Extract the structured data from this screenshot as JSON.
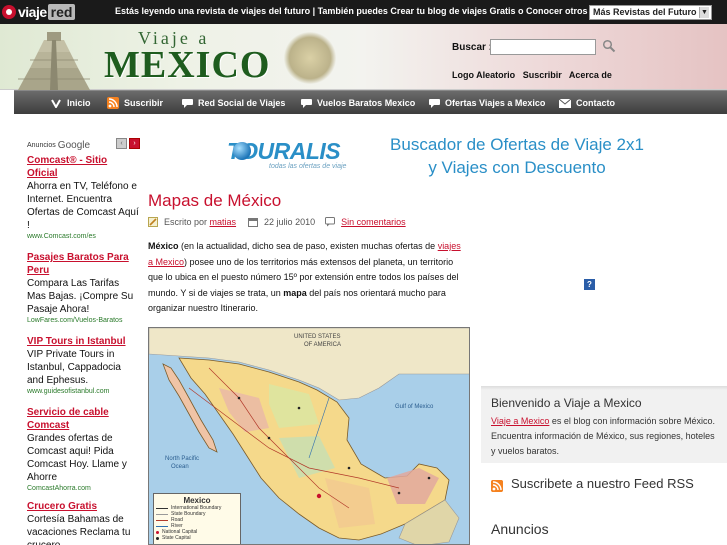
{
  "topbar": {
    "logo_part1": "viaje",
    "logo_part2": "red",
    "message": "Estás leyendo una revista de viajes del futuro | También puedes Crear tu blog de viajes Gratis o Conocer otros viajeros",
    "more_select": "Más Revistas del Futuro",
    "select_arrow": "▼"
  },
  "header": {
    "title_small": "Viaje a",
    "title_big": "MEXICO",
    "search_label": "Buscar :",
    "search_value": "",
    "links": [
      "Logo Aleatorio",
      "Suscribir",
      "Acerca de"
    ]
  },
  "nav": {
    "items": [
      {
        "label": "Inicio",
        "icon": "v-icon"
      },
      {
        "label": "Suscribir",
        "icon": "rss-icon"
      },
      {
        "label": "Red Social de Viajes",
        "icon": "chat-icon"
      },
      {
        "label": "Vuelos Baratos Mexico",
        "icon": "chat-icon"
      },
      {
        "label": "Ofertas Viajes a Mexico",
        "icon": "chat-icon"
      },
      {
        "label": "Contacto",
        "icon": "mail-icon"
      }
    ]
  },
  "ads": {
    "header": "Anuncios",
    "brand": "Google",
    "prev": "‹",
    "next": "›",
    "items": [
      {
        "title": "Comcast® - Sitio Oficial",
        "body": "Ahorra en TV, Teléfono e Internet. Encuentra Ofertas de Comcast Aquí !",
        "url": "www.Comcast.com/es"
      },
      {
        "title": "Pasajes Baratos Para Peru",
        "body": "Compara Las Tarifas Mas Bajas. ¡Compre Su Pasaje Ahora!",
        "url": "LowFares.com/Vuelos-Baratos"
      },
      {
        "title": "VIP Tours in Istanbul",
        "body": "VIP Private Tours in Istanbul, Cappadocia and Ephesus.",
        "url": "www.guidesofistanbul.com"
      },
      {
        "title": "Servicio de cable Comcast",
        "body": "Grandes ofertas de Comcast aqui! Pida Comcast Hoy. Llame y Ahorre",
        "url": "ComcastAhorra.com"
      },
      {
        "title": "Crucero Gratis",
        "body": "Cortesía Bahamas de vacaciones Reclama tu crucero",
        "url": ""
      }
    ]
  },
  "touralis": {
    "name": "TOURALIS",
    "tagline": "todas las ofertas de viaje"
  },
  "promo": {
    "line1": "Buscador de Ofertas de Viaje 2x1",
    "line2": "y  Viajes con Descuento"
  },
  "post": {
    "title": "Mapas de México",
    "written_by": "Escrito por",
    "author": "matias",
    "date": "22 julio 2010",
    "comments": "Sin comentarios",
    "body": {
      "w1": "México",
      "t1": " (en la actualidad, dicho sea de paso, existen muchas ofertas de ",
      "link": "viajes a Mexico",
      "t2": ") posee uno de los territorios más extensos del planeta, un territorio que lo ubica en el puesto número 15º por extensión entre todos los países del mundo. Y si de viajes se trata, un ",
      "w2": "mapa",
      "t3": " del país nos orientará mucho para organizar nuestro Itinerario."
    }
  },
  "map": {
    "labels": {
      "usa": "UNITED STATES",
      "of": "OF AMERICA",
      "gulf": "Gulf of Mexico",
      "pacific1": "North Pacific",
      "pacific2": "Ocean"
    },
    "legend_title": "Mexico",
    "legend_rows": [
      "International Boundary",
      "State Boundary",
      "Road",
      "River",
      "National Capital",
      "State Capital"
    ]
  },
  "badge": "?",
  "sidebar": {
    "welcome_title": "Bienvenido a Viaje a Mexico",
    "welcome_link": "Viaje a Mexico",
    "welcome_text": " es el blog con información sobre México. Encuentra información de México, sus regiones, hoteles y vuelos baratos.",
    "rss_text": "Suscribete a nuestro Feed RSS",
    "anuncios": "Anuncios"
  },
  "colors": {
    "accent_red": "#c8102e",
    "link_blue": "#2a8fc7",
    "nav_dark": "#3d3d3d",
    "rss_orange": "#f58220"
  }
}
